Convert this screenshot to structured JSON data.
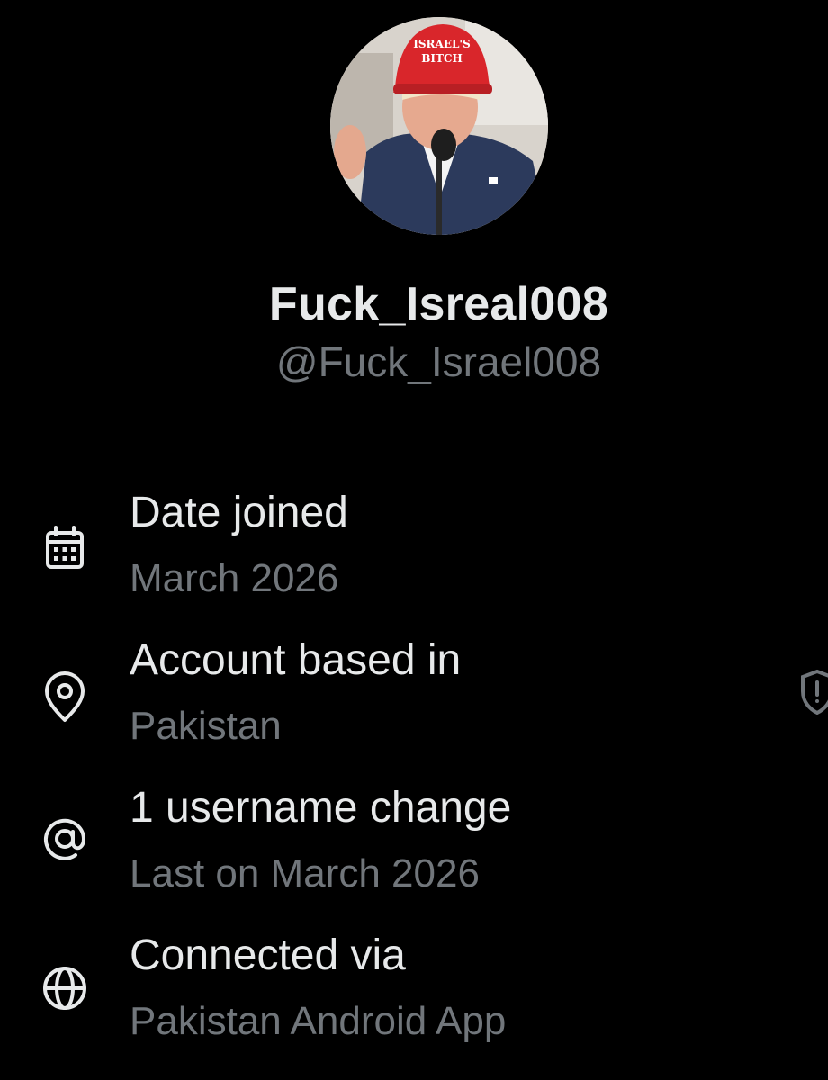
{
  "profile": {
    "display_name": "Fuck_Isreal008",
    "handle": "@Fuck_Israel008",
    "avatar_hat_text": [
      "ISRAEL'S",
      "BITCH"
    ]
  },
  "about": [
    {
      "icon": "calendar-icon",
      "title": "Date joined",
      "subtitle": "March 2026"
    },
    {
      "icon": "location-pin-icon",
      "title": "Account based in",
      "subtitle": "Pakistan"
    },
    {
      "icon": "at-sign-icon",
      "title": "1 username change",
      "subtitle": "Last on March 2026"
    },
    {
      "icon": "globe-icon",
      "title": "Connected via",
      "subtitle": "Pakistan Android App"
    }
  ],
  "colors": {
    "background": "#000000",
    "primary_text": "#e7e9ea",
    "secondary_text": "#71767b"
  }
}
